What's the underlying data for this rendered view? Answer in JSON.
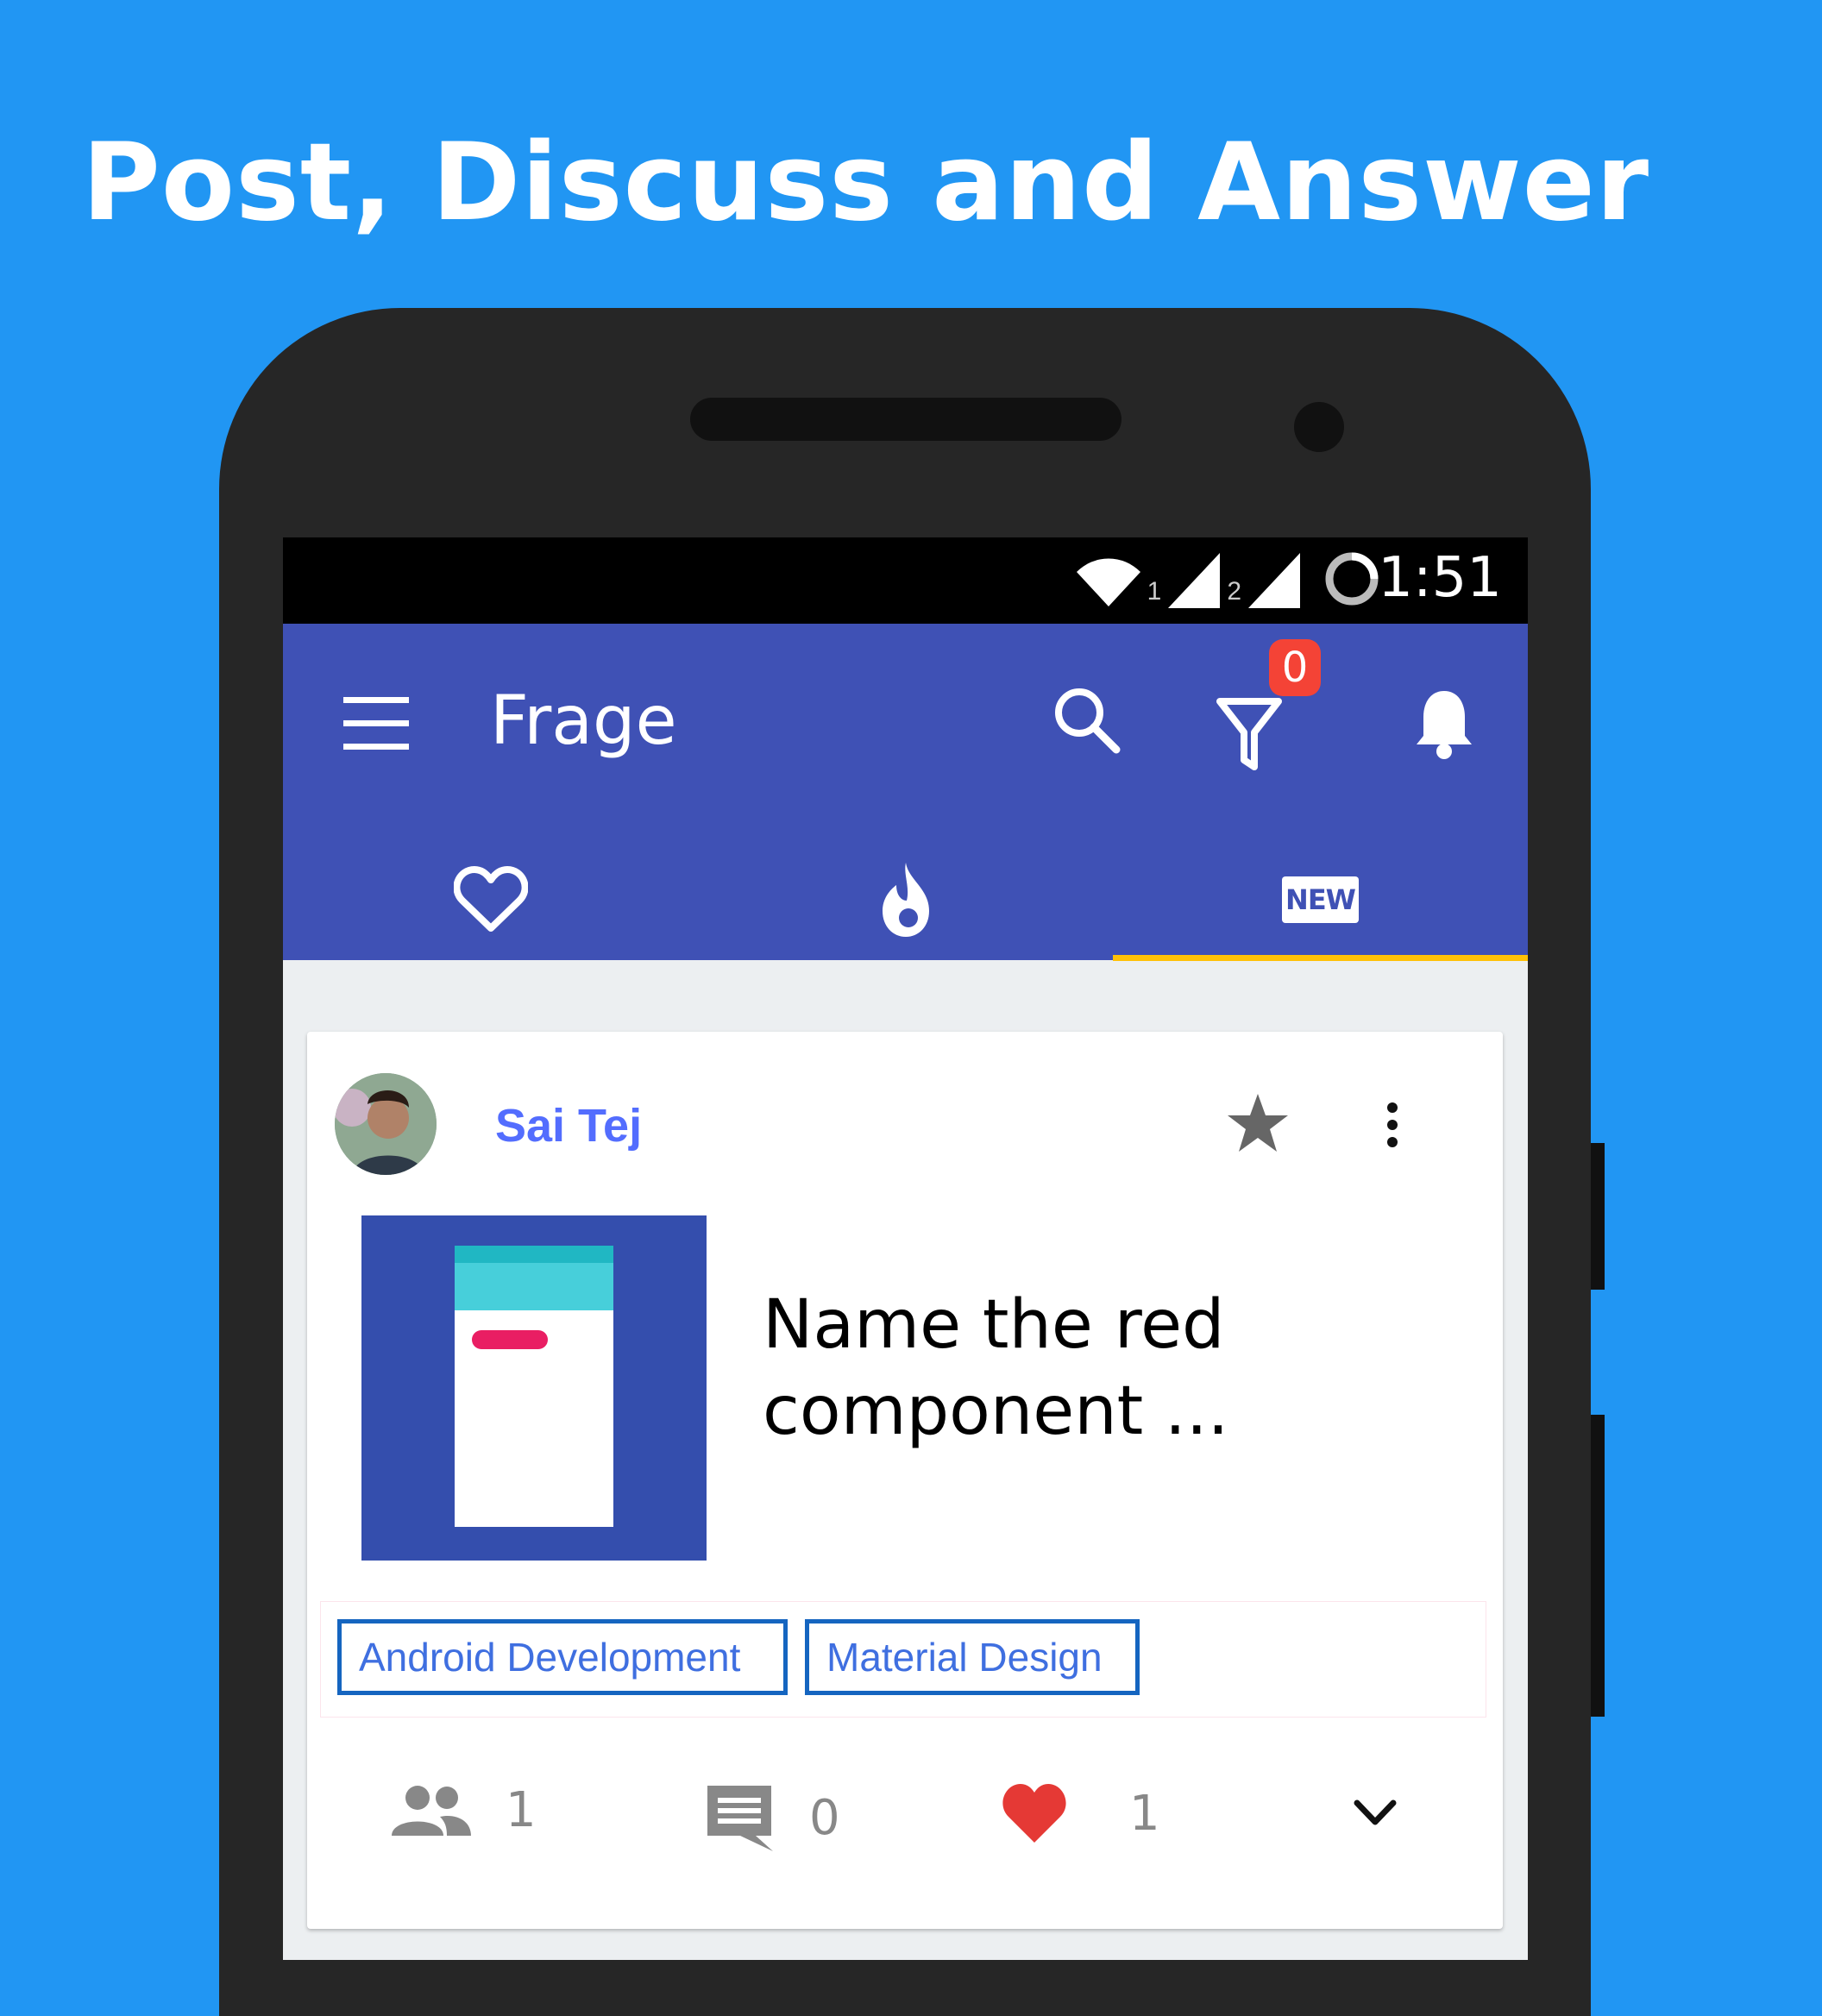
{
  "promo": {
    "headline": "Post, Discuss and Answer"
  },
  "status_bar": {
    "time": "1:51",
    "sim1": "1",
    "sim2": "2"
  },
  "app_bar": {
    "title": "Frage",
    "filter_badge": "0"
  },
  "tabs": [
    {
      "icon": "heart-outline-icon"
    },
    {
      "icon": "flame-icon"
    },
    {
      "icon": "new-icon",
      "label": "NEW",
      "selected": true
    }
  ],
  "post": {
    "author": "Sai Tej",
    "question": "Name the red component ...",
    "tags": [
      "Android Development",
      "Material Design"
    ],
    "followers": "1",
    "comments": "0",
    "likes": "1"
  },
  "colors": {
    "background": "#2196F3",
    "app_bar": "#3F51B5",
    "tab_indicator": "#FFC107",
    "badge": "#F44336",
    "like": "#E53935",
    "author": "#536DFE"
  }
}
